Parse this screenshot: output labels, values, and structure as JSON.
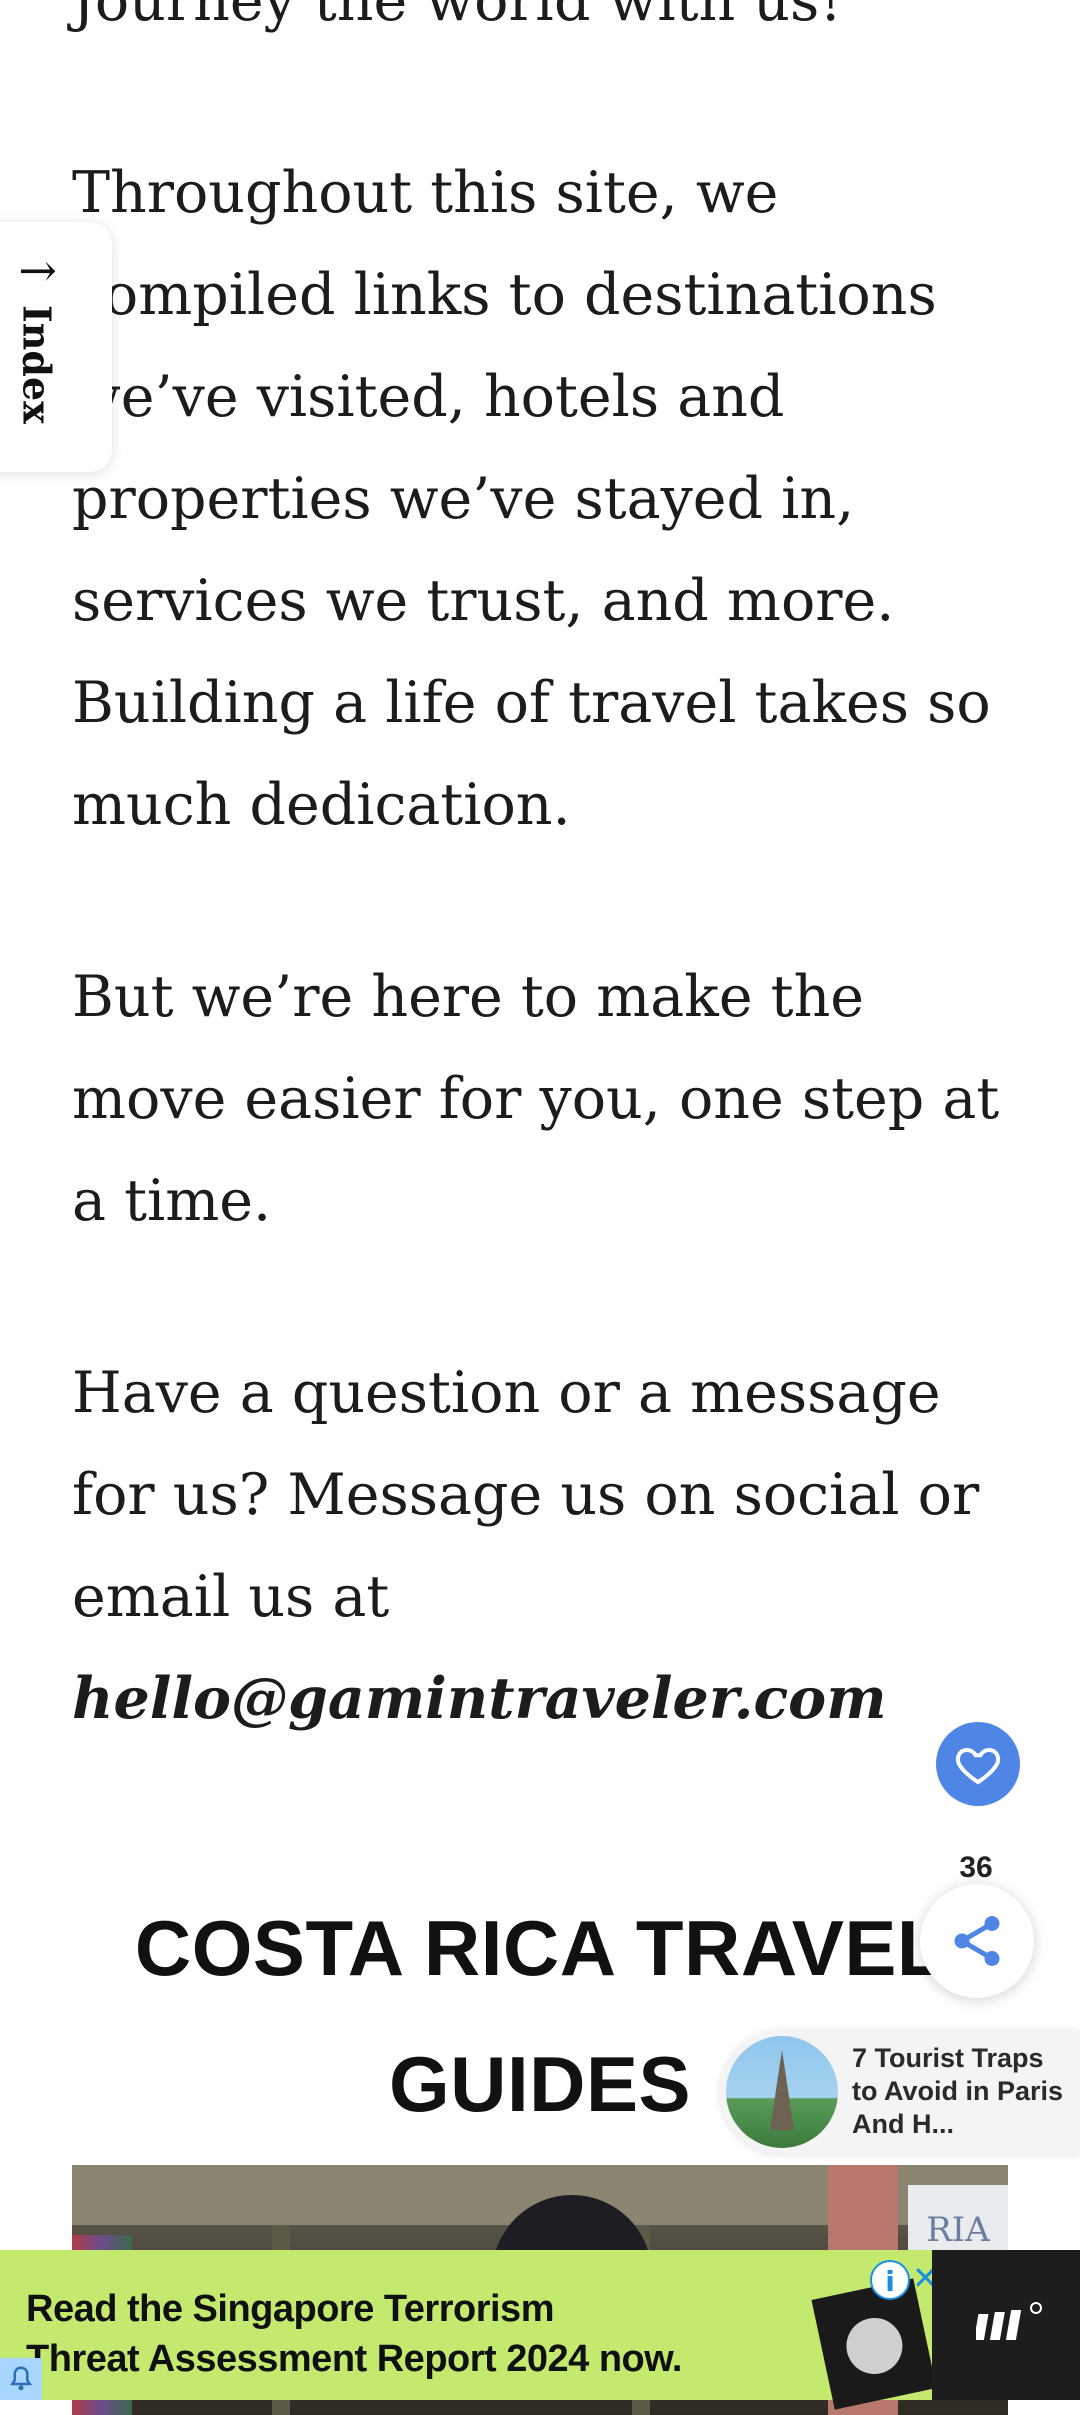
{
  "article": {
    "para_intro": "Journey the world with us!",
    "para_links": "Throughout this site, we compiled links to destinations we’ve visited, hotels and properties we’ve stayed in, services we trust, and more. Building a life of travel takes so much dedication.",
    "para_move": "But we’re here to make the move easier for you, one step at a time.",
    "para_contact_lead": "Have a question or a message for us? Message us on social or email us at",
    "email": "hello@gamintraveler.com"
  },
  "index_tab": {
    "label": "Index",
    "icon": "arrow-up-icon"
  },
  "section": {
    "title": "COSTA RICA TRAVEL GUIDES"
  },
  "social": {
    "like_icon": "heart-icon",
    "share_count": "36",
    "share_icon": "share-icon"
  },
  "promo": {
    "title": "7 Tourist Traps to Avoid in Paris And H..."
  },
  "ad": {
    "headline_line1": "Read the Singapore Terrorism",
    "headline_line2": "Threat Assessment Report 2024 now.",
    "info_label": "i",
    "close_label": "✕",
    "accent_color": "#c3ea6f"
  },
  "photo": {
    "sign_text": "RIA"
  }
}
